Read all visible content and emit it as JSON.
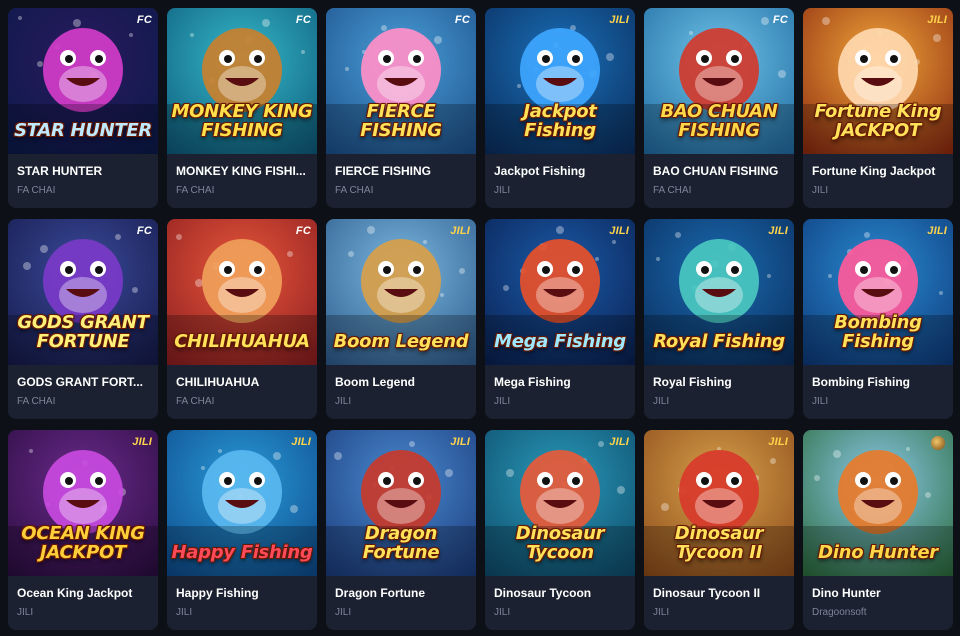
{
  "games": [
    {
      "name": "STAR HUNTER",
      "provider": "FA CHAI",
      "badge": "FC",
      "art_text": "STAR HUNTER",
      "bg": [
        "#2a1a5e",
        "#0b1a4a"
      ],
      "accent": "#d23cc9",
      "text_color": "#bfe9ff"
    },
    {
      "name": "MONKEY KING FISHI...",
      "provider": "FA CHAI",
      "badge": "FC",
      "art_text": "MONKEY KING FISHING",
      "bg": [
        "#35b8c8",
        "#0d5a7a"
      ],
      "accent": "#c9802e",
      "text_color": "#ffe04a"
    },
    {
      "name": "FIERCE FISHING",
      "provider": "FA CHAI",
      "badge": "FC",
      "art_text": "FIERCE FISHING",
      "bg": [
        "#4a9fd8",
        "#1c4f8a"
      ],
      "accent": "#ff8fc8",
      "text_color": "#ffe15a"
    },
    {
      "name": "Jackpot Fishing",
      "provider": "JILI",
      "badge": "JILI",
      "art_text": "Jackpot Fishing",
      "bg": [
        "#1a6fb8",
        "#0a2d5c"
      ],
      "accent": "#3ea6ff",
      "text_color": "#ffe15a"
    },
    {
      "name": "BAO CHUAN FISHING",
      "provider": "FA CHAI",
      "badge": "FC",
      "art_text": "BAO CHUAN FISHING",
      "bg": [
        "#6fc3e8",
        "#1f6aa0"
      ],
      "accent": "#d33a2c",
      "text_color": "#ffd84a"
    },
    {
      "name": "Fortune King Jackpot",
      "provider": "JILI",
      "badge": "JILI",
      "art_text": "Fortune King JACKPOT",
      "bg": [
        "#f1a63a",
        "#8c2a10"
      ],
      "accent": "#ffd9b0",
      "text_color": "#ffe15a"
    },
    {
      "name": "GODS GRANT FORT...",
      "provider": "FA CHAI",
      "badge": "FC",
      "art_text": "GODS GRANT FORTUNE",
      "bg": [
        "#3a4a9a",
        "#151a4a"
      ],
      "accent": "#7a3ac8",
      "text_color": "#fff07a"
    },
    {
      "name": "CHILIHUAHUA",
      "provider": "FA CHAI",
      "badge": "FC",
      "art_text": "CHILIHUAHUA",
      "bg": [
        "#e8563a",
        "#8a1d20"
      ],
      "accent": "#f0a05a",
      "text_color": "#ffe15a"
    },
    {
      "name": "Boom Legend",
      "provider": "JILI",
      "badge": "JILI",
      "art_text": "Boom Legend",
      "bg": [
        "#7ab8e0",
        "#2d5a8a"
      ],
      "accent": "#d8a04a",
      "text_color": "#ffe15a"
    },
    {
      "name": "Mega Fishing",
      "provider": "JILI",
      "badge": "JILI",
      "art_text": "Mega Fishing",
      "bg": [
        "#1a5aa8",
        "#0a2050"
      ],
      "accent": "#e8502a",
      "text_color": "#9fe8ff"
    },
    {
      "name": "Royal Fishing",
      "provider": "JILI",
      "badge": "JILI",
      "art_text": "Royal Fishing",
      "bg": [
        "#1a6ab0",
        "#0a2d5c"
      ],
      "accent": "#4ac8c0",
      "text_color": "#ffe15a"
    },
    {
      "name": "Bombing Fishing",
      "provider": "JILI",
      "badge": "JILI",
      "art_text": "Bombing Fishing",
      "bg": [
        "#2a8ad0",
        "#0d3a7a"
      ],
      "accent": "#ff5a9a",
      "text_color": "#ffe15a"
    },
    {
      "name": "Ocean King Jackpot",
      "provider": "JILI",
      "badge": "JILI",
      "art_text": "OCEAN KING JACKPOT",
      "bg": [
        "#6a2a8a",
        "#2a0d40"
      ],
      "accent": "#c84ae0",
      "text_color": "#ffcf3a"
    },
    {
      "name": "Happy Fishing",
      "provider": "JILI",
      "badge": "JILI",
      "art_text": "Happy Fishing",
      "bg": [
        "#2a9ad8",
        "#0d4a8a"
      ],
      "accent": "#5ab8f0",
      "text_color": "#ff4a5a"
    },
    {
      "name": "Dragon Fortune",
      "provider": "JILI",
      "badge": "JILI",
      "art_text": "Dragon Fortune",
      "bg": [
        "#4a8ad0",
        "#1a3a7a"
      ],
      "accent": "#c83a2a",
      "text_color": "#ffe15a"
    },
    {
      "name": "Dinosaur Tycoon",
      "provider": "JILI",
      "badge": "JILI",
      "art_text": "Dinosaur Tycoon",
      "bg": [
        "#2a9ab8",
        "#0d4a6a"
      ],
      "accent": "#e85a3a",
      "text_color": "#ffe15a"
    },
    {
      "name": "Dinosaur Tycoon II",
      "provider": "JILI",
      "badge": "JILI",
      "art_text": "Dinosaur Tycoon II",
      "bg": [
        "#d8a04a",
        "#8a4a1a"
      ],
      "accent": "#d83a2a",
      "text_color": "#ffe15a"
    },
    {
      "name": "Dino Hunter",
      "provider": "Dragoonsoft",
      "badge": "",
      "art_text": "Dino Hunter",
      "bg": [
        "#8ac8e8",
        "#2a6a3a"
      ],
      "accent": "#e87a2a",
      "text_color": "#ffd84a"
    }
  ]
}
